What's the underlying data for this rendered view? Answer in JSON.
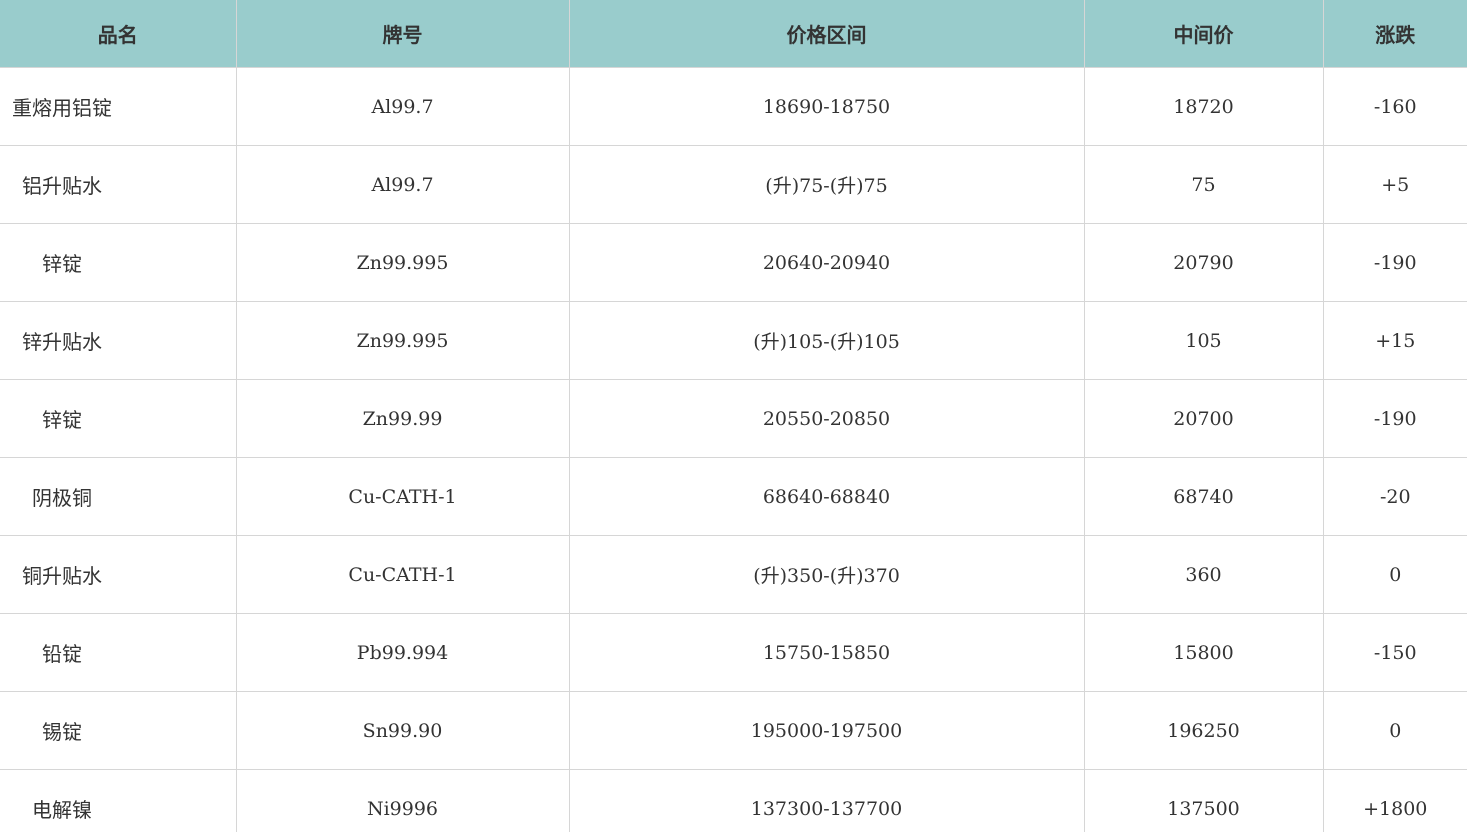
{
  "table": {
    "headers": [
      "品名",
      "牌号",
      "价格区间",
      "中间价",
      "涨跌"
    ],
    "rows": [
      [
        "重熔用铝锭",
        "Al99.7",
        "18690-18750",
        "18720",
        "-160"
      ],
      [
        "铝升贴水",
        "Al99.7",
        "(升)75-(升)75",
        "75",
        "+5"
      ],
      [
        "锌锭",
        "Zn99.995",
        "20640-20940",
        "20790",
        "-190"
      ],
      [
        "锌升贴水",
        "Zn99.995",
        "(升)105-(升)105",
        "105",
        "+15"
      ],
      [
        "锌锭",
        "Zn99.99",
        "20550-20850",
        "20700",
        "-190"
      ],
      [
        "阴极铜",
        "Cu-CATH-1",
        "68640-68840",
        "68740",
        "-20"
      ],
      [
        "铜升贴水",
        "Cu-CATH-1",
        "(升)350-(升)370",
        "360",
        "0"
      ],
      [
        "铅锭",
        "Pb99.994",
        "15750-15850",
        "15800",
        "-150"
      ],
      [
        "锡锭",
        "Sn99.90",
        "195000-197500",
        "196250",
        "0"
      ],
      [
        "电解镍",
        "Ni9996",
        "137300-137700",
        "137500",
        "+1800"
      ]
    ]
  },
  "colors": {
    "header_bg": "#99cccc",
    "grid": "#d6d6d6",
    "text": "#333333"
  }
}
